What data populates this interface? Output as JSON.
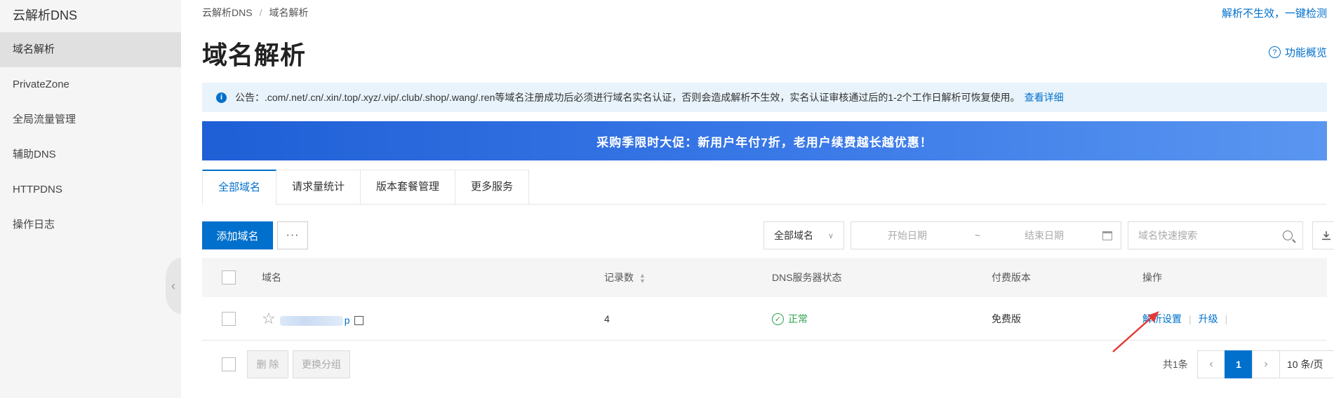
{
  "sidebar": {
    "brand": "云解析DNS",
    "items": [
      {
        "label": "域名解析",
        "active": true
      },
      {
        "label": "PrivateZone"
      },
      {
        "label": "全局流量管理"
      },
      {
        "label": "辅助DNS"
      },
      {
        "label": "HTTPDNS"
      },
      {
        "label": "操作日志"
      }
    ]
  },
  "header": {
    "breadcrumb": [
      "云解析DNS",
      "域名解析"
    ],
    "breadcrumb_sep": "/",
    "check_link": "解析不生效，一键检测",
    "title": "域名解析",
    "overview_label": "功能概览"
  },
  "notice": {
    "text": "公告：.com/.net/.cn/.xin/.top/.xyz/.vip/.club/.shop/.wang/.ren等域名注册成功后必须进行域名实名认证，否则会造成解析不生效，实名认证审核通过后的1-2个工作日解析可恢复使用。",
    "link": "查看详细"
  },
  "promo": {
    "text": "采购季限时大促：新用户年付7折，老用户续费越长越优惠！"
  },
  "tabs": [
    {
      "label": "全部域名",
      "active": true
    },
    {
      "label": "请求量统计"
    },
    {
      "label": "版本套餐管理"
    },
    {
      "label": "更多服务"
    }
  ],
  "toolbar": {
    "add_label": "添加域名",
    "more_label": "···",
    "group_select": "全部域名",
    "start_date_placeholder": "开始日期",
    "date_sep": "~",
    "end_date_placeholder": "结束日期",
    "search_placeholder": "域名快速搜索"
  },
  "table": {
    "columns": {
      "name": "域名",
      "records": "记录数",
      "dns_status": "DNS服务器状态",
      "version": "付费版本",
      "ops": "操作"
    },
    "rows": [
      {
        "domain_suffix": "p",
        "records": "4",
        "dns_status": "正常",
        "version": "免费版",
        "op_resolve": "解析设置",
        "op_upgrade": "升级"
      }
    ]
  },
  "footer": {
    "delete_label": "删 除",
    "change_group_label": "更换分组",
    "total": "共1条",
    "current_page": "1",
    "page_size": "10 条/页"
  },
  "colors": {
    "accent": "#0070cc",
    "ok": "#2ba24c",
    "annotation": "#e53935"
  }
}
